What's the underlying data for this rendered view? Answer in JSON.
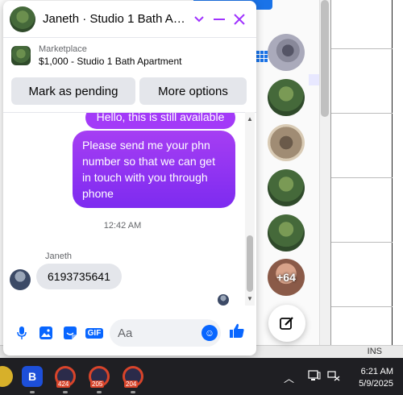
{
  "chat": {
    "title": "Janeth · Studio 1 Bath Apa...",
    "marketplace_label": "Marketplace",
    "listing_title": "$1,000 - Studio 1 Bath Apartment",
    "buttons": {
      "mark_pending": "Mark as pending",
      "more_options": "More options"
    },
    "messages": {
      "out_1": "Hello, this is still available",
      "out_2": "Please send me your phn number so that we can get in touch with you through phone",
      "timestamp": "12:42 AM",
      "sender_name": "Janeth",
      "in_1": "6193735641"
    },
    "composer_placeholder": "Aa",
    "gif_label": "GIF"
  },
  "rail": {
    "more_count": "+64"
  },
  "status_bar": {
    "ins_label": "INS"
  },
  "taskbar": {
    "badges": [
      "424",
      "205",
      "204"
    ],
    "time": "6:21 AM",
    "date": "5/9/2025"
  },
  "colors": {
    "accent": "#a033ff",
    "messenger_blue": "#0866ff",
    "bubble_grad_start": "#a63ef3",
    "bubble_grad_end": "#7d2bf0"
  }
}
